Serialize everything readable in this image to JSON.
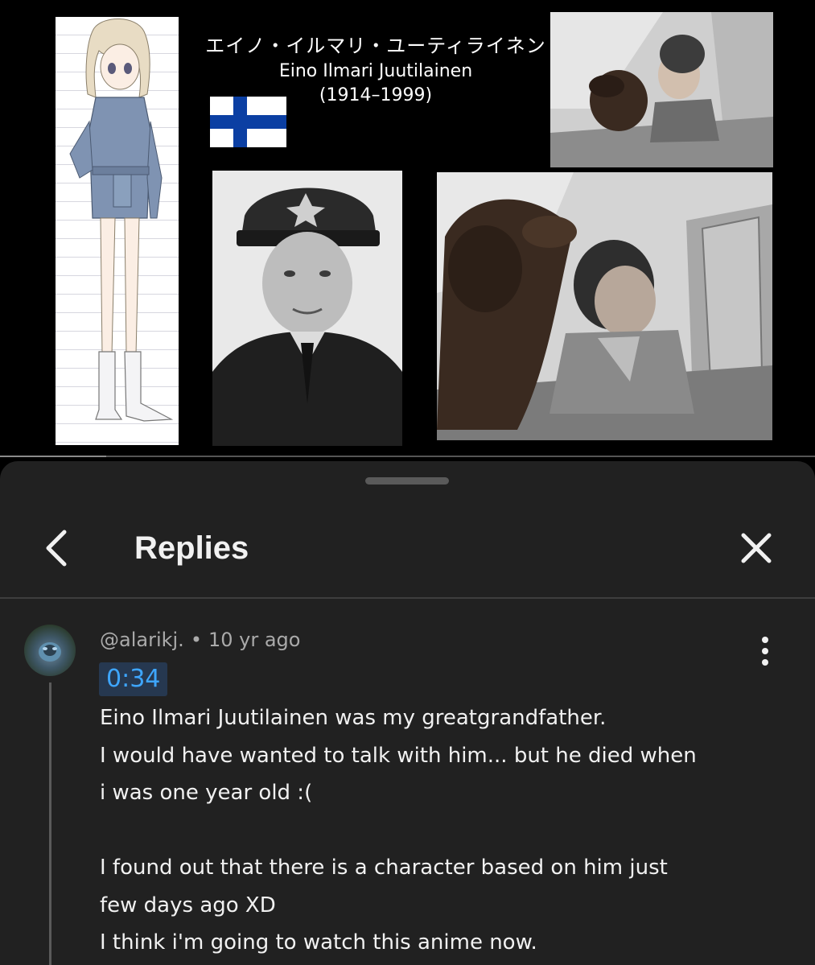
{
  "video": {
    "caption_jp": "エイノ・イルマリ・ユーティライネン",
    "caption_name": "Eino Ilmari Juutilainen",
    "caption_years": "(1914–1999)",
    "progress_fraction": 0.13
  },
  "panel": {
    "title": "Replies"
  },
  "comment": {
    "author": "@alarikj.",
    "separator": "•",
    "age": "10 yr ago",
    "timestamp_link": "0:34",
    "lines": [
      "Eino Ilmari Juutilainen was my greatgrandfather.",
      "I would have wanted to talk with him... but he died when",
      "i was one year old :(",
      "",
      "I found out that there is a character based on him just",
      "few days ago XD",
      "I think i'm going to watch this anime now."
    ]
  },
  "colors": {
    "panel_bg": "#212121",
    "link_blue": "#3ea6ff",
    "timestamp_bg": "#263850",
    "finland_blue": "#0b3fa3"
  },
  "icons": {
    "back": "chevron-left-icon",
    "close": "close-icon",
    "more": "more-vertical-icon"
  }
}
